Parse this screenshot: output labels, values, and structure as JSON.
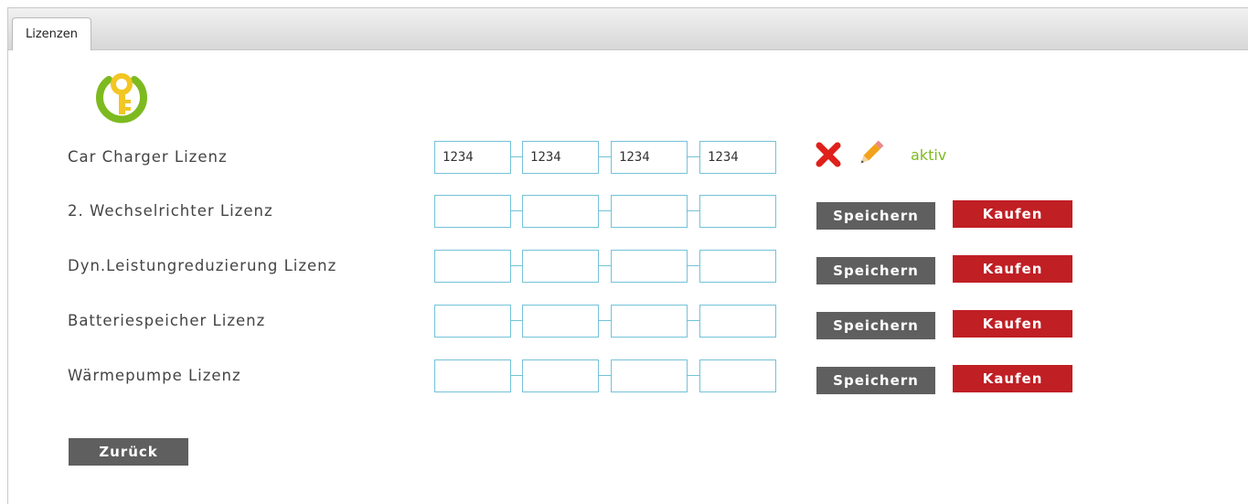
{
  "tabs": [
    {
      "label": "Lizenzen"
    }
  ],
  "licenses": [
    {
      "label": "Car Charger Lizenz",
      "segments": [
        "1234",
        "1234",
        "1234",
        "1234"
      ],
      "state": "active",
      "status_text": "aktiv"
    },
    {
      "label": "2. Wechselrichter Lizenz",
      "segments": [
        "",
        "",
        "",
        ""
      ],
      "state": "inactive",
      "save_label": "Speichern",
      "buy_label": "Kaufen"
    },
    {
      "label": "Dyn.Leistungreduzierung Lizenz",
      "segments": [
        "",
        "",
        "",
        ""
      ],
      "state": "inactive",
      "save_label": "Speichern",
      "buy_label": "Kaufen"
    },
    {
      "label": "Batteriespeicher Lizenz",
      "segments": [
        "",
        "",
        "",
        ""
      ],
      "state": "inactive",
      "save_label": "Speichern",
      "buy_label": "Kaufen"
    },
    {
      "label": "Wärmepumpe Lizenz",
      "segments": [
        "",
        "",
        "",
        ""
      ],
      "state": "inactive",
      "save_label": "Speichern",
      "buy_label": "Kaufen"
    }
  ],
  "back_label": "Zurück",
  "icons": {
    "logo": "key-power-icon",
    "delete": "delete-x-icon",
    "edit": "pencil-icon"
  },
  "colors": {
    "accent_green": "#7dba1f",
    "key_yellow": "#f2c623",
    "input_border": "#74c2d8",
    "save_button": "#5f5f5f",
    "buy_button": "#c01f24",
    "delete_red": "#e0201b"
  }
}
